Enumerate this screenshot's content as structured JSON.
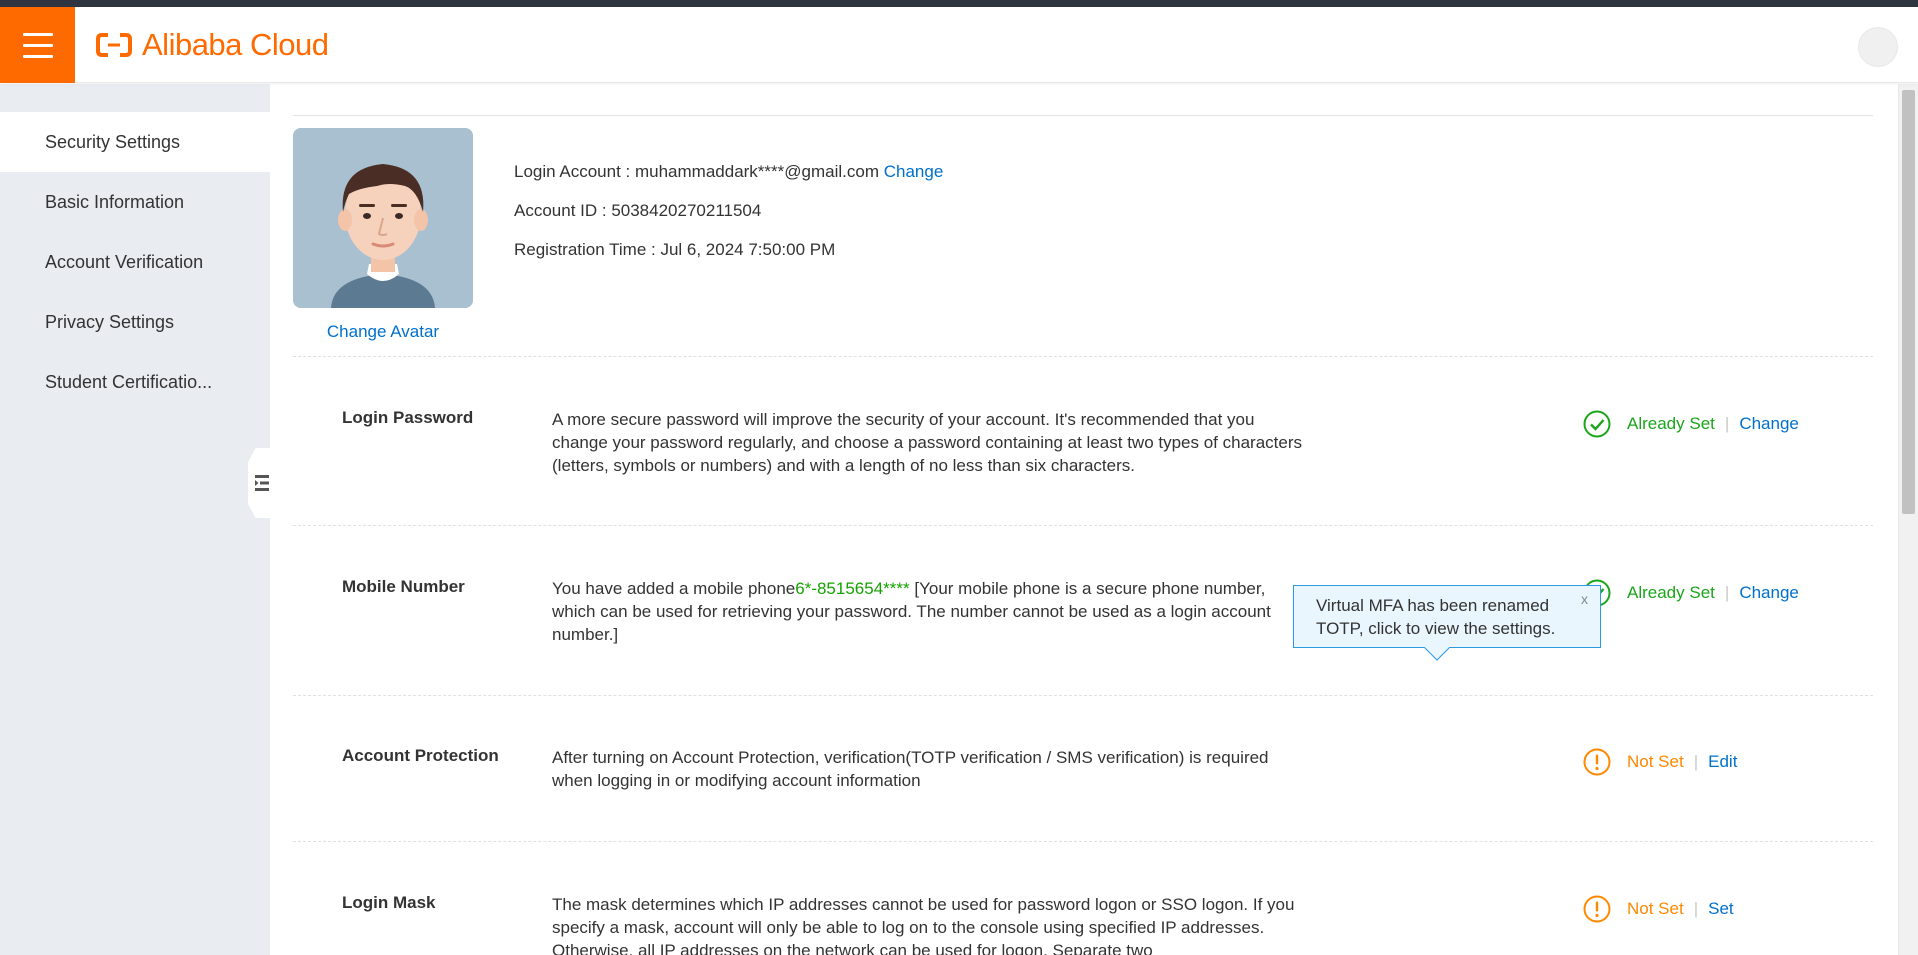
{
  "header": {
    "brand": "Alibaba Cloud",
    "menu_icon": "hamburger-menu-icon"
  },
  "sidebar": {
    "items": [
      {
        "label": "Security Settings",
        "active": true
      },
      {
        "label": "Basic Information",
        "active": false
      },
      {
        "label": "Account Verification",
        "active": false
      },
      {
        "label": "Privacy Settings",
        "active": false
      },
      {
        "label": "Student Certificatio...",
        "active": false
      }
    ]
  },
  "profile": {
    "change_avatar": "Change Avatar",
    "login_account_label": "Login Account : ",
    "login_account_value": "muhammaddark****@gmail.com",
    "change_link": "Change",
    "account_id": "Account ID : 5038420270211504",
    "registration_time": "Registration Time : Jul 6, 2024 7:50:00 PM"
  },
  "rows": {
    "login_password": {
      "title": "Login Password",
      "desc": "A more secure password will improve the security of your account. It's recommended that you change your password regularly, and choose a password containing at least two types of characters (letters, symbols or numbers) and with a length of no less than six characters.",
      "status": "Already Set",
      "action": "Change"
    },
    "mobile_number": {
      "title": "Mobile Number",
      "desc_prefix": "You have added a mobile phone",
      "phone": "6*-8515654****",
      "desc_suffix": " [Your mobile phone is a secure phone number, which can be used for retrieving your password. The number cannot be used as a login account number.]",
      "status": "Already Set",
      "action": "Change"
    },
    "account_protection": {
      "title": "Account Protection",
      "desc": "After turning on Account Protection, verification(TOTP verification / SMS verification) is required when logging in or modifying account information",
      "status": "Not Set",
      "action": "Edit"
    },
    "login_mask": {
      "title": "Login Mask",
      "desc": "The mask determines which IP addresses cannot be used for password logon or SSO logon. If you specify a mask, account will only be able to log on to the console using specified IP addresses. Otherwise, all IP addresses on the network can be used for logon. Separate two",
      "status": "Not Set",
      "action": "Set"
    }
  },
  "tooltip": {
    "text": "Virtual MFA has been renamed TOTP, click to view the settings.",
    "close": "x"
  },
  "colors": {
    "brand": "#ff6a00",
    "link": "#0070cc",
    "ok": "#1aa51a",
    "warn": "#ff8800"
  }
}
